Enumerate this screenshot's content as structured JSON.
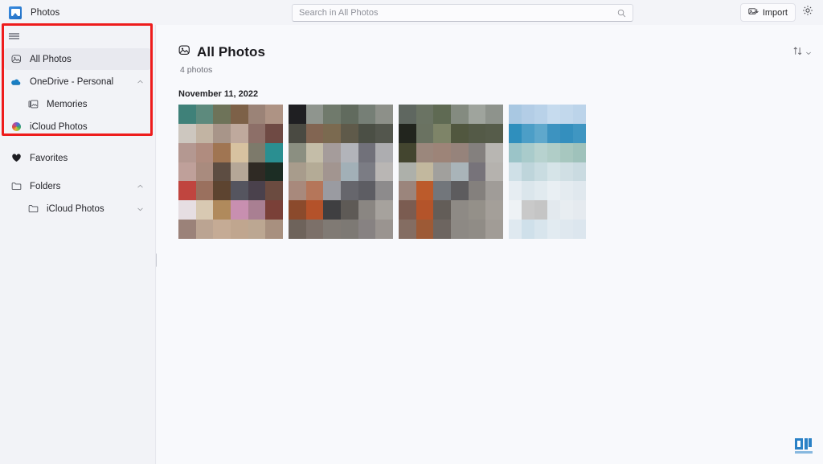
{
  "window": {
    "app_icon": "photos-app-icon",
    "title": "Photos"
  },
  "search": {
    "placeholder": "Search in All Photos",
    "value": "",
    "icon": "search-icon"
  },
  "toolbar": {
    "import_label": "Import",
    "import_icon": "import-photo-icon",
    "settings_icon": "gear-icon"
  },
  "sidebar": {
    "menu_icon": "hamburger-menu-icon",
    "items": [
      {
        "label": "All Photos",
        "icon": "all-photos-icon",
        "selected": true,
        "sub": false,
        "chevron": ""
      },
      {
        "label": "OneDrive - Personal",
        "icon": "onedrive-icon",
        "selected": false,
        "sub": false,
        "chevron": "up"
      },
      {
        "label": "Memories",
        "icon": "memories-icon",
        "selected": false,
        "sub": true,
        "chevron": ""
      },
      {
        "label": "iCloud Photos",
        "icon": "icloud-photos-icon",
        "selected": false,
        "sub": false,
        "chevron": ""
      },
      {
        "label": "Favorites",
        "icon": "heart-icon",
        "selected": false,
        "sub": false,
        "chevron": ""
      },
      {
        "label": "Folders",
        "icon": "folder-icon",
        "selected": false,
        "sub": false,
        "chevron": "up"
      },
      {
        "label": "iCloud Photos",
        "icon": "folder-icon",
        "selected": false,
        "sub": true,
        "chevron": "down"
      }
    ],
    "splitter": "sidebar-resize-handle"
  },
  "annotation": {
    "color": "#ee1c1c",
    "shape": "rectangle-highlight"
  },
  "main": {
    "title": "All Photos",
    "title_icon": "all-photos-icon",
    "count_label": "4 photos",
    "sort_icon": "sort-arrows-icon",
    "sort_chevron": "chevron-down-icon",
    "date_group": "November 11, 2022",
    "photos": [
      {
        "name": "photo-1",
        "alt": "blurred photo thumbnail 1"
      },
      {
        "name": "photo-2",
        "alt": "blurred photo thumbnail 2"
      },
      {
        "name": "photo-3",
        "alt": "blurred photo thumbnail 3"
      },
      {
        "name": "photo-4",
        "alt": "blurred photo thumbnail 4"
      }
    ]
  },
  "watermark": {
    "name": "site-watermark-logo",
    "color": "#1f7bc4"
  }
}
